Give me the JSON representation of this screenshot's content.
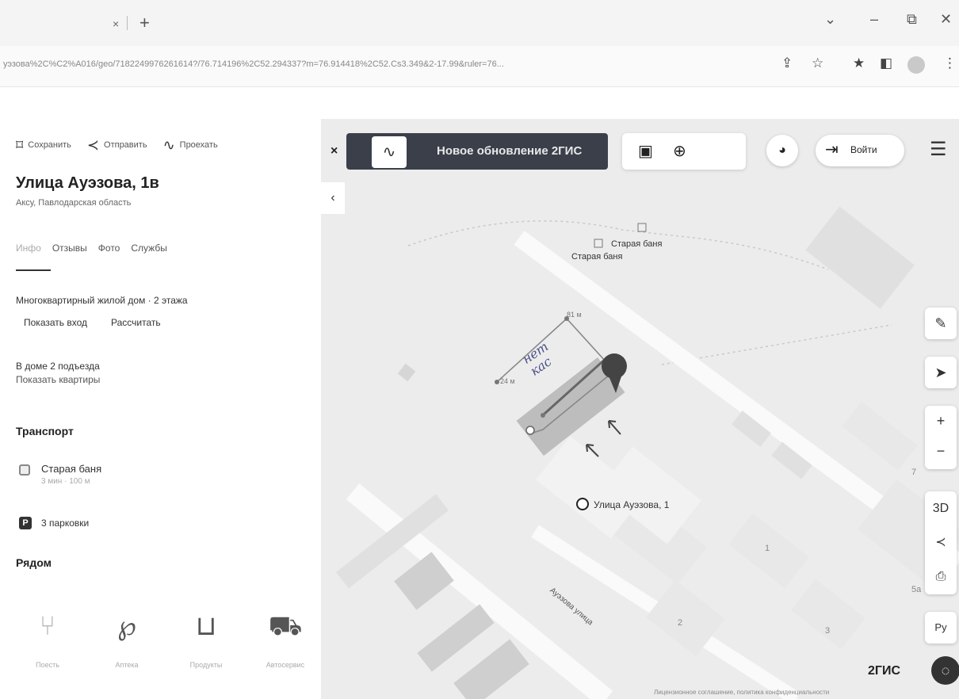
{
  "browser": {
    "tab_close": "×",
    "tab_new": "+",
    "url": "уэзова%2C%C2%A016/geo/7182249976261614?/76.714196%2C52.294337?m=76.914418%2C52.Cs3.349&2-17.99&ruler=76...",
    "win_min": "–",
    "win_max": "⧉",
    "win_close": "✕",
    "win_dropdown": "⌄"
  },
  "panel": {
    "actions": {
      "save": "Сохранить",
      "share": "Отправить",
      "route": "Проехать"
    },
    "title": "Улица Ауэзова, 1в",
    "subtitle": "Аксу, Павлодарская область",
    "tabs": [
      "Инфо",
      "Отзывы",
      "Фото",
      "Службы"
    ],
    "building_info": "Многоквартирный жилой дом · 2 этажа",
    "show_entrance": "Показать вход",
    "calculate": "Рассчитать",
    "entrances": "В доме 2 подъезда",
    "show_apartments": "Показать квартиры",
    "transport_heading": "Транспорт",
    "stop_name": "Старая баня",
    "stop_sub": "3 мин · 100 м",
    "parking_letter": "P",
    "parking": "3 парковки",
    "nearby_heading": "Рядом",
    "categories": [
      {
        "label": "Поесть",
        "icon": "⑂"
      },
      {
        "label": "Аптека",
        "icon": "℘"
      },
      {
        "label": "Продукты",
        "icon": "⊔"
      },
      {
        "label": "Автосервис",
        "icon": "⛟"
      }
    ]
  },
  "map": {
    "banner_close": "×",
    "banner_text": "Новое обновление 2ГИС",
    "login": "Войти",
    "collapse": "‹",
    "label_stop": "Старая баня",
    "label_stop2": "Старая баня",
    "label_address": "Улица Ауэзова, 1",
    "label_street": "Ауэзова улица",
    "label_81m": "81 м",
    "label_24m": "24 м",
    "label_1": "1",
    "label_2": "2",
    "label_3": "3",
    "label_5a": "5а",
    "label_7": "7",
    "handwriting_1": "нет",
    "handwriting_2": "кас",
    "layer_3d": "3D",
    "lang": "Ру",
    "brand": "2ГИС",
    "footer": "Лицензионное соглашение, политика конфиденциальности"
  }
}
